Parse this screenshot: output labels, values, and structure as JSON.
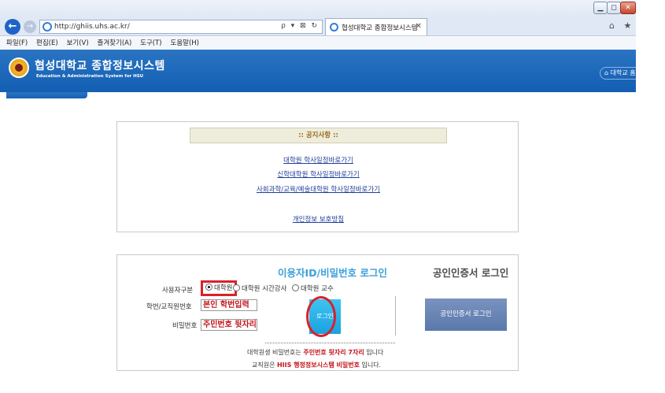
{
  "browser": {
    "window_buttons": {
      "minimize": "▁",
      "maximize": "◻",
      "close": "✕"
    },
    "address": {
      "url": "http://ghiis.uhs.ac.kr/",
      "tools": "ρ ▾ ⊠ ↻"
    },
    "tab": {
      "title": "협성대학교 종합정보시스템",
      "close": "✕"
    },
    "nav_right_icons": "⌂ ★"
  },
  "menu": {
    "items": [
      "파일(F)",
      "편집(E)",
      "보기(V)",
      "즐겨찾기(A)",
      "도구(T)",
      "도움말(H)"
    ]
  },
  "header": {
    "title": "협성대학교 종합정보시스템",
    "subtitle": "Education & Administration System for HSU",
    "home_link": "⌂ 대학교 홈"
  },
  "notice": {
    "heading": ":: 공지사항 ::",
    "links": [
      "대학원 학사일정바로가기",
      "신학대학원 학사일정바로가기",
      "사회과학/교육/예술대학원 학사일정바로가기"
    ],
    "privacy_link": "개인정보 보호방침"
  },
  "login": {
    "title": "이용자ID/비밀번호 로그인",
    "cert_title": "공인인증서 로그인",
    "user_type_label": "사용자구분",
    "user_types": [
      "대학원",
      "대학원 시간강사",
      "대학원 교수"
    ],
    "selected_type": "대학원",
    "id_label": "학번/교직원번호",
    "id_value": "본인 학번입력",
    "pw_label": "비밀번호",
    "pw_value": "주민번호 뒷자리",
    "login_button": "로그인",
    "cert_button": "공인인증서 로그인",
    "info_1_prefix": "대학원생 비밀번호는 ",
    "info_1_emph": "주민번호 뒷자리 7자리",
    "info_1_suffix": " 입니다",
    "info_2_prefix": "교직원은 ",
    "info_2_emph": "HIIS 행정정보시스템 비밀번호",
    "info_2_suffix": " 입니다."
  },
  "colors": {
    "header_blue": "#1760b5",
    "login_title": "#3ba0dc",
    "highlight_red": "#d9212b",
    "login_button": "#1aa2de",
    "cert_button": "#5a78ab"
  }
}
